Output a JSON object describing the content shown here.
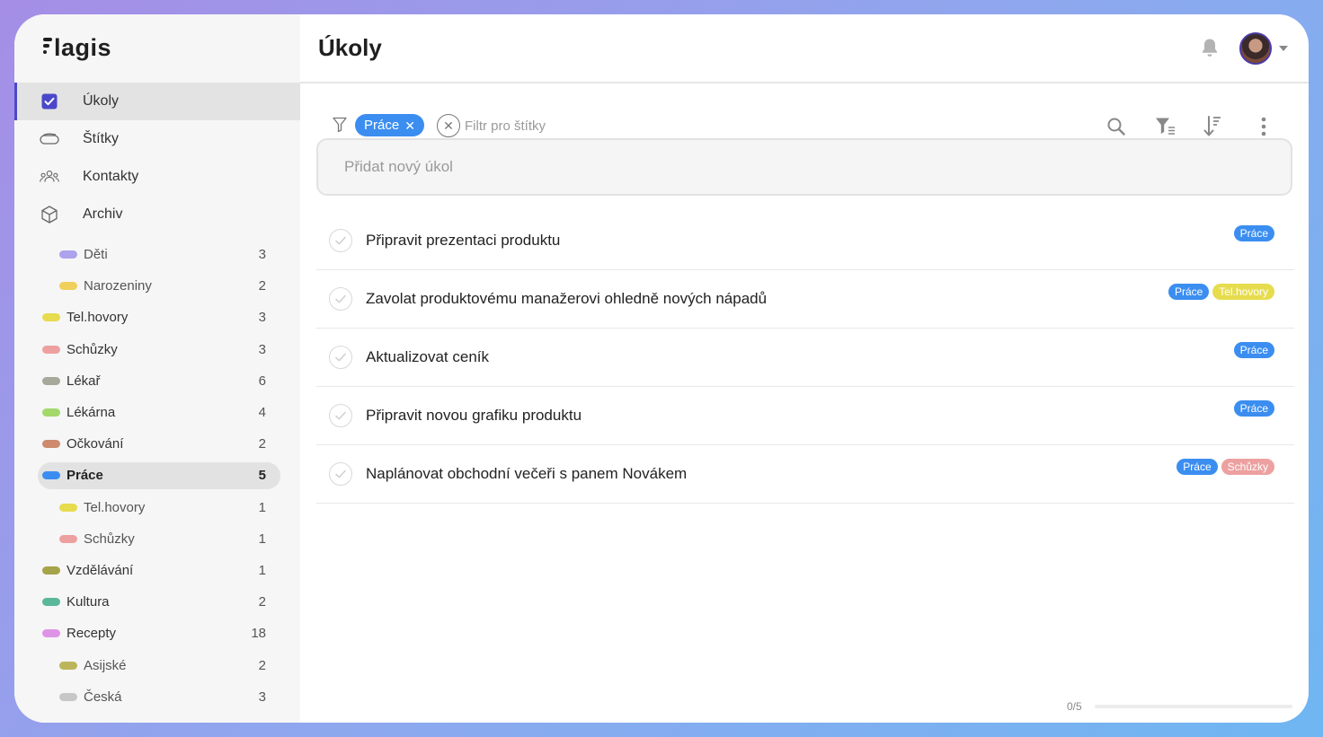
{
  "app": {
    "logo_text": "lagis"
  },
  "nav": [
    {
      "label": "Úkoly",
      "icon": "checkbox-icon",
      "active": true
    },
    {
      "label": "Štítky",
      "icon": "tag-icon",
      "active": false
    },
    {
      "label": "Kontakty",
      "icon": "people-icon",
      "active": false
    },
    {
      "label": "Archiv",
      "icon": "archive-icon",
      "active": false
    }
  ],
  "tags": [
    {
      "label": "Děti",
      "count": "3",
      "color": "#ada2ec",
      "level": 2
    },
    {
      "label": "Narozeniny",
      "count": "2",
      "color": "#f0cf5a",
      "level": 2
    },
    {
      "label": "Tel.hovory",
      "count": "3",
      "color": "#e6dc4e",
      "level": 1
    },
    {
      "label": "Schůzky",
      "count": "3",
      "color": "#eda0a0",
      "level": 1
    },
    {
      "label": "Lékař",
      "count": "6",
      "color": "#a6a89a",
      "level": 1
    },
    {
      "label": "Lékárna",
      "count": "4",
      "color": "#a3d86a",
      "level": 1
    },
    {
      "label": "Očkování",
      "count": "2",
      "color": "#cd8a6c",
      "level": 1
    },
    {
      "label": "Práce",
      "count": "5",
      "color": "#3b8ef0",
      "level": 1,
      "selected": true
    },
    {
      "label": "Tel.hovory",
      "count": "1",
      "color": "#e6dc4e",
      "level": 2
    },
    {
      "label": "Schůzky",
      "count": "1",
      "color": "#eda0a0",
      "level": 2
    },
    {
      "label": "Vzdělávání",
      "count": "1",
      "color": "#a6a44a",
      "level": 1
    },
    {
      "label": "Kultura",
      "count": "2",
      "color": "#5ab79a",
      "level": 1
    },
    {
      "label": "Recepty",
      "count": "18",
      "color": "#dd94e6",
      "level": 1
    },
    {
      "label": "Asijské",
      "count": "2",
      "color": "#bcb55a",
      "level": 2
    },
    {
      "label": "Česká",
      "count": "3",
      "color": "#c7c7c7",
      "level": 2
    }
  ],
  "header": {
    "title": "Úkoly"
  },
  "filter": {
    "chip_label": "Práce",
    "placeholder": "Filtr pro štítky"
  },
  "new_task": {
    "placeholder": "Přidat nový úkol"
  },
  "tag_colors": {
    "Práce": "#3b8ef0",
    "Tel.hovory": "#e6dc4e",
    "Schůzky": "#eda0a0"
  },
  "tasks": [
    {
      "title": "Připravit prezentaci produktu",
      "tags": [
        "Práce"
      ]
    },
    {
      "title": "Zavolat produktovému manažerovi ohledně nových nápadů",
      "tags": [
        "Práce",
        "Tel.hovory"
      ]
    },
    {
      "title": "Aktualizovat ceník",
      "tags": [
        "Práce"
      ]
    },
    {
      "title": "Připravit novou grafiku produktu",
      "tags": [
        "Práce"
      ]
    },
    {
      "title": "Naplánovat obchodní večeři s panem Novákem",
      "tags": [
        "Práce",
        "Schůzky"
      ]
    }
  ],
  "progress": {
    "label": "0/5",
    "fraction": 0
  }
}
